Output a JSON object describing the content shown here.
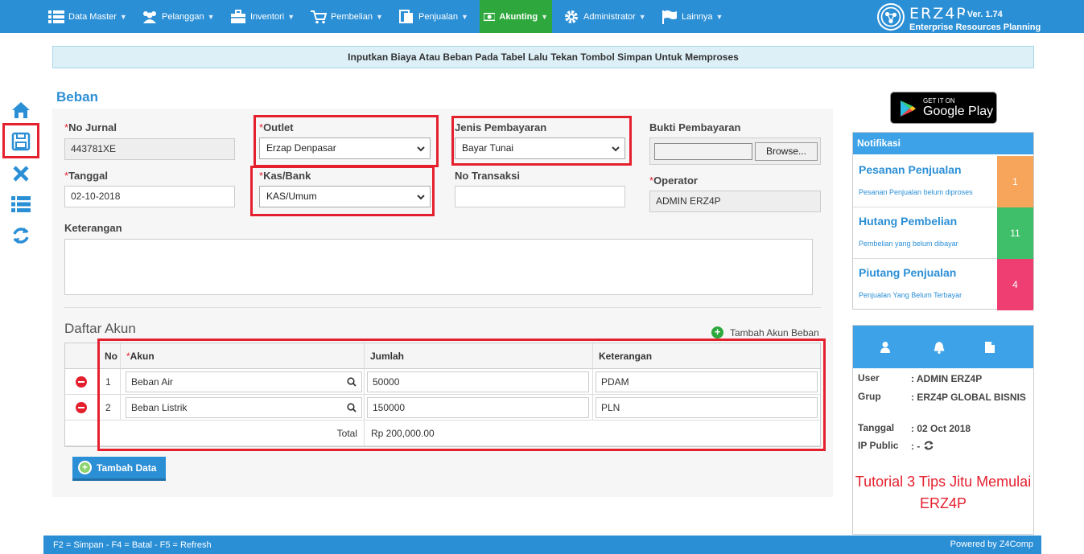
{
  "nav": {
    "items": [
      {
        "label": "Data Master",
        "icon": "list-icon"
      },
      {
        "label": "Pelanggan",
        "icon": "users-icon"
      },
      {
        "label": "Inventori",
        "icon": "briefcase-icon"
      },
      {
        "label": "Pembelian",
        "icon": "cart-icon"
      },
      {
        "label": "Penjualan",
        "icon": "document-icon"
      },
      {
        "label": "Akunting",
        "icon": "money-icon",
        "active": true
      },
      {
        "label": "Administrator",
        "icon": "gear-icon"
      },
      {
        "label": "Lainnya",
        "icon": "flag-icon"
      }
    ],
    "brand": {
      "name": "ERZ4P",
      "version": "- Ver. 1.74",
      "subtitle": "Enterprise Resources Planning"
    }
  },
  "info_message": "Inputkan Biaya Atau Beban Pada Tabel Lalu Tekan Tombol Simpan Untuk Memproses",
  "side_tools": [
    "home-icon",
    "save-icon",
    "close-icon",
    "list-icon",
    "refresh-icon"
  ],
  "form": {
    "title": "Beban",
    "no_jurnal": {
      "label": "No Jurnal",
      "value": "443781XE"
    },
    "tanggal": {
      "label": "Tanggal",
      "value": "02-10-2018"
    },
    "outlet": {
      "label": "Outlet",
      "value": "Erzap Denpasar"
    },
    "kas_bank": {
      "label": "Kas/Bank",
      "value": "KAS/Umum"
    },
    "jenis_pembayaran": {
      "label": "Jenis Pembayaran",
      "value": "Bayar Tunai"
    },
    "no_transaksi": {
      "label": "No Transaksi",
      "value": ""
    },
    "bukti_pembayaran": {
      "label": "Bukti Pembayaran",
      "browse": "Browse..."
    },
    "operator": {
      "label": "Operator",
      "value": "ADMIN ERZ4P"
    },
    "keterangan": {
      "label": "Keterangan",
      "value": ""
    },
    "required_mark": "*"
  },
  "daftar_akun": {
    "title": "Daftar Akun",
    "add_link": "Tambah Akun Beban",
    "columns": {
      "no": "No",
      "akun": "Akun",
      "jumlah": "Jumlah",
      "keterangan": "Keterangan"
    },
    "rows": [
      {
        "no": "1",
        "akun": "Beban Air",
        "jumlah": "50000",
        "keterangan": "PDAM"
      },
      {
        "no": "2",
        "akun": "Beban Listrik",
        "jumlah": "150000",
        "keterangan": "PLN"
      }
    ],
    "total_label": "Total",
    "total_value": "Rp 200,000.00",
    "add_button": "Tambah Data"
  },
  "google_play": {
    "line1": "GET IT ON",
    "line2": "Google Play"
  },
  "notifications": {
    "title": "Notifikasi",
    "items": [
      {
        "title": "Pesanan Penjualan",
        "subtitle": "Pesanan Penjualan belum diproses",
        "count": "1",
        "color": "#f6a55a"
      },
      {
        "title": "Hutang Pembelian",
        "subtitle": "Pembelian yang belum dibayar",
        "count": "11",
        "color": "#3fbf6a"
      },
      {
        "title": "Piutang Penjualan",
        "subtitle": "Penjualan Yang Belum Terbayar",
        "count": "4",
        "color": "#ee3e72"
      }
    ]
  },
  "user_info": {
    "user_label": "User",
    "user_value": ": ADMIN ERZ4P",
    "grup_label": "Grup",
    "grup_value": ": ERZ4P GLOBAL BISNIS",
    "tanggal_label": "Tanggal",
    "tanggal_value": ": 02 Oct 2018",
    "ip_label": "IP Public",
    "ip_value": ": -",
    "tutorial": "Tutorial 3 Tips Jitu Memulai ERZ4P"
  },
  "footer": {
    "shortcuts": "F2 = Simpan - F4 = Batal - F5 = Refresh",
    "powered": "Powered by Z4Comp"
  },
  "colors": {
    "primary": "#2b8fd6",
    "active_menu": "#2ea83c",
    "highlight": "#e5202e"
  }
}
